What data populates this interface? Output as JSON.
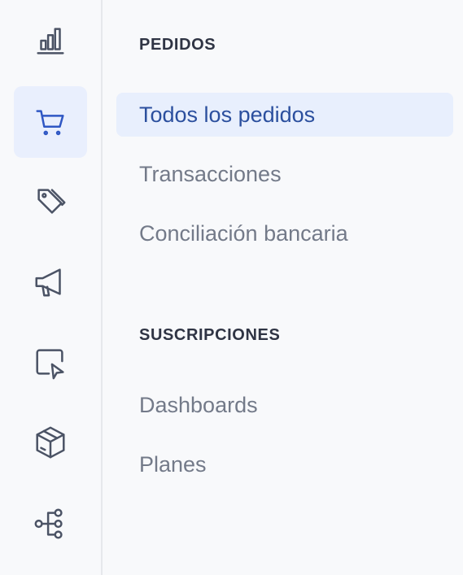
{
  "rail": {
    "items": [
      {
        "icon": "bar-chart-icon",
        "active": false
      },
      {
        "icon": "shopping-cart-icon",
        "active": true
      },
      {
        "icon": "tags-icon",
        "active": false
      },
      {
        "icon": "megaphone-icon",
        "active": false
      },
      {
        "icon": "cursor-screen-icon",
        "active": false
      },
      {
        "icon": "package-box-icon",
        "active": false
      },
      {
        "icon": "workflow-icon",
        "active": false
      }
    ]
  },
  "subnav": {
    "sections": [
      {
        "title": "PEDIDOS",
        "items": [
          {
            "label": "Todos los pedidos",
            "active": true
          },
          {
            "label": "Transacciones",
            "active": false
          },
          {
            "label": "Conciliación bancaria",
            "active": false
          }
        ]
      },
      {
        "title": "SUSCRIPCIONES",
        "items": [
          {
            "label": "Dashboards",
            "active": false
          },
          {
            "label": "Planes",
            "active": false
          }
        ]
      }
    ]
  },
  "colors": {
    "background": "#f8f9fb",
    "active_bg": "#e8effd",
    "active_text": "#2b4f9e",
    "muted_text": "#737a89",
    "icon": "#4b5365"
  }
}
